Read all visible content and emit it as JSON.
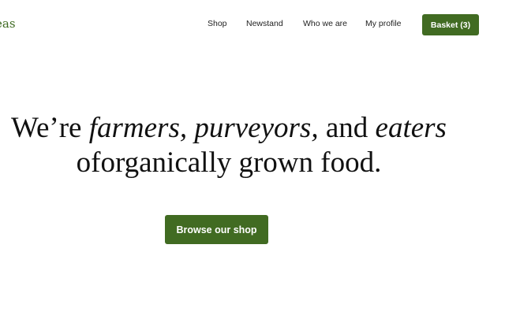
{
  "header": {
    "logo_text": "eas",
    "nav": [
      {
        "label": "Shop"
      },
      {
        "label": "Newstand"
      },
      {
        "label": "Who we are"
      },
      {
        "label": "My profile"
      }
    ],
    "basket_label": "Basket (3)"
  },
  "hero": {
    "w1": "We’re ",
    "w2": "farmers, purveyors,",
    "w3": " and ",
    "w4": "eaters",
    "line2": "oforganically grown food."
  },
  "cta": {
    "label": "Browse our shop"
  },
  "colors": {
    "accent": "#416b22",
    "logo": "#3f6b22"
  }
}
